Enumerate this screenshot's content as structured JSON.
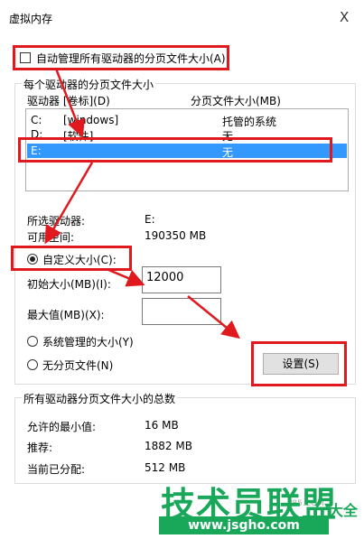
{
  "window": {
    "title": "虚拟内存",
    "close_glyph": "X"
  },
  "auto_manage": {
    "label": "自动管理所有驱动器的分页文件大小(A)",
    "checked": false
  },
  "per_drive_group": {
    "label": "每个驱动器的分页文件大小",
    "columns": [
      "驱动器 [卷标](D)",
      "分页文件大小(MB)"
    ],
    "rows": [
      {
        "drive": "C:",
        "volume": "[windows]",
        "size": "托管的系统",
        "selected": false
      },
      {
        "drive": "D:",
        "volume": "[软件]",
        "size": "无",
        "selected": false
      },
      {
        "drive": "E:",
        "volume": "",
        "size": "无",
        "selected": true
      }
    ],
    "selected_drive_label": "所选驱动器:",
    "selected_drive_value": "E:",
    "free_space_label": "可用空间:",
    "free_space_value": "190350 MB",
    "custom_size_label": "自定义大小(C):",
    "custom_size_selected": true,
    "initial_size_label": "初始大小(MB)(I):",
    "initial_size_value": "12000",
    "max_size_label": "最大值(MB)(X):",
    "max_size_value": "",
    "system_managed_label": "系统管理的大小(Y)",
    "no_paging_label": "无分页文件(N)",
    "set_button": "设置(S)"
  },
  "total_group": {
    "label": "所有驱动器分页文件大小的总数",
    "min_label": "允许的最小值:",
    "min_value": "16 MB",
    "recommended_label": "推荐:",
    "recommended_value": "1882 MB",
    "current_label": "当前已分配:",
    "current_value": "512 MB"
  },
  "watermark": {
    "main": "技术员联盟",
    "url": "www.jsgho.com",
    "side": "大全",
    "tiny": "P85.COM"
  },
  "colors": {
    "highlight": "#e0191f",
    "selection": "#3399ff",
    "watermark": "#19a75a"
  }
}
